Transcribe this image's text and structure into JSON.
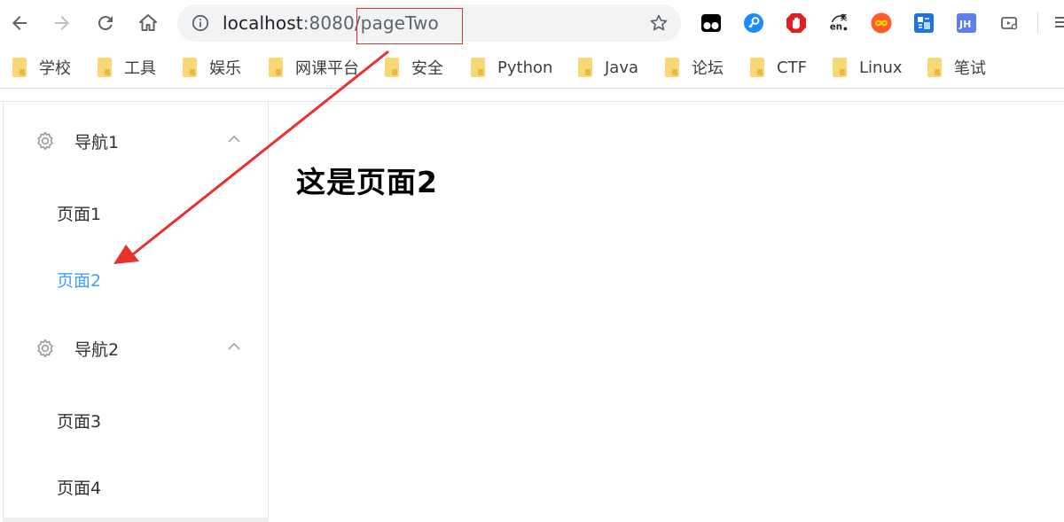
{
  "browser": {
    "url_host": "localhost",
    "url_rest": ":8080/pageTwo",
    "extensions": [
      {
        "name": "tampermonkey-icon",
        "color": "#000000"
      },
      {
        "name": "key-icon",
        "color": "#1a8cff"
      },
      {
        "name": "adblock-icon",
        "color": "#e02020"
      },
      {
        "name": "translate-icon",
        "color": "#333333",
        "glyph": "en"
      },
      {
        "name": "infinity-icon",
        "color": "#ff5a2c"
      },
      {
        "name": "ext-blue-icon",
        "color": "#1a73e8"
      },
      {
        "name": "jh-icon",
        "color": "#5b7ff1",
        "glyph": "JH"
      },
      {
        "name": "cast-icon",
        "color": "#5f6368"
      }
    ]
  },
  "bookmarks": [
    "学校",
    "工具",
    "娱乐",
    "网课平台",
    "安全",
    "Python",
    "Java",
    "论坛",
    "CTF",
    "Linux",
    "笔试"
  ],
  "sidebar": {
    "groups": [
      {
        "title": "导航1",
        "items": [
          "页面1",
          "页面2"
        ]
      },
      {
        "title": "导航2",
        "items": [
          "页面3",
          "页面4"
        ]
      }
    ],
    "active_item": "页面2",
    "active_color": "#409eff"
  },
  "main": {
    "heading": "这是页面2"
  },
  "annotation": {
    "color": "#e8302f"
  }
}
